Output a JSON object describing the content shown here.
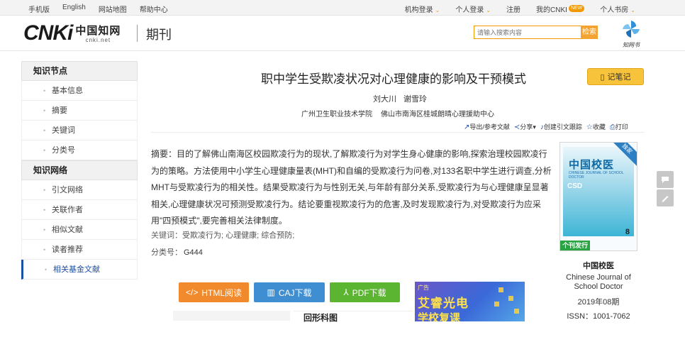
{
  "topbar": {
    "left_links": [
      "手机版",
      "English",
      "网站地图",
      "帮助中心"
    ],
    "institution_login": "机构登录",
    "personal_login": "个人登录",
    "register": "注册",
    "my_cnki": "我的CNKI",
    "new_badge": "NEW",
    "personal_library": "个人书房"
  },
  "header": {
    "logo_cnki": "CNKi",
    "logo_cn": "中国知网",
    "logo_url": "cnki.net",
    "section": "期刊",
    "search_placeholder": "请输入搜索内容",
    "search_button": "检索",
    "zhiwang_label": "知网书"
  },
  "sidebar": {
    "knowledge_node": "知识节点",
    "node_items": [
      "基本信息",
      "摘要",
      "关键词",
      "分类号"
    ],
    "knowledge_network": "知识网络",
    "network_items": [
      "引文网络",
      "关联作者",
      "相似文献",
      "读者推荐",
      "相关基金文献"
    ]
  },
  "article": {
    "title": "职中学生受欺凌状况对心理健康的影响及干预模式",
    "note_button": "记笔记",
    "authors": [
      "刘大川",
      "谢雪玲"
    ],
    "affiliations": [
      "广州卫生职业技术学院",
      "佛山市南海区桂城朗晴心理援助中心"
    ],
    "tools": {
      "export": "导出/参考文献",
      "share": "分享",
      "cite_track": "创建引文跟踪",
      "favorite": "收藏",
      "print": "打印"
    },
    "abstract_label": "摘要：",
    "abstract": "目的了解佛山南海区校园欺凌行为的现状,了解欺凌行为对学生身心健康的影响,探索治理校园欺凌行为的策略。方法使用中小学生心理健康量表(MHT)和自编的受欺凌行为问卷,对133名职中学生进行调查,分析MHT与受欺凌行为的相关性。结果受欺凌行为与性别无关,与年龄有部分关系,受欺凌行为与心理健康呈显著相关,心理健康状况可预测受欺凌行为。结论要重视欺凌行为的危害,及时发现欺凌行为,对受欺凌行为应采用\"四预模式\",要完善相关法律制度。",
    "keywords_label": "关键词：",
    "keywords": "受欺凌行为; 心理健康; 综合预防;",
    "class_label": "分类号：",
    "class_value": "G444"
  },
  "downloads": {
    "html": "HTML阅读",
    "caj": "CAJ下载",
    "pdf": "PDF下载"
  },
  "below": {
    "left_partial": "",
    "right_partial": "回形科图"
  },
  "ad": {
    "tag": "广告",
    "line1": "艾睿光电",
    "line2": "学校复课"
  },
  "journal": {
    "cover_cn": "中国校医",
    "cover_en": "CHINESE JOURNAL OF SCHOOL DOCTOR",
    "cover_csd": "CSD",
    "cover_issue_num": "8",
    "cover_corner": "独家",
    "monthly_tag": "个刊发行",
    "name": "中国校医",
    "name_en": "Chinese Journal of School Doctor",
    "issue": "2019年08期",
    "issn": "ISSN：1001-7062"
  },
  "colors": {
    "accent_orange": "#f39800",
    "link_blue": "#1e50a2",
    "html_btn": "#f08a2d",
    "caj_btn": "#3f8ed2",
    "pdf_btn": "#5cb531"
  }
}
